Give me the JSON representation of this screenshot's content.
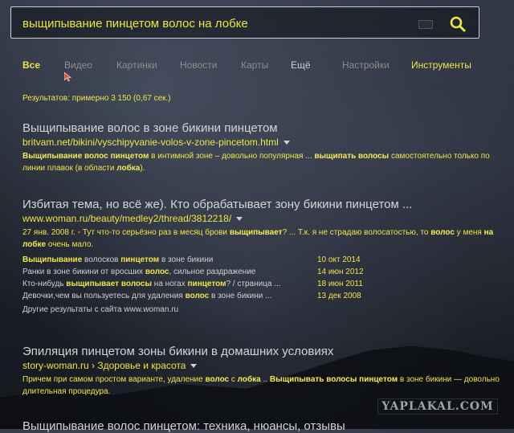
{
  "search": {
    "query": "выщипывание пинцетом волос на лобке"
  },
  "tabs": [
    {
      "label": "Все"
    },
    {
      "label": "Видео"
    },
    {
      "label": "Картинки"
    },
    {
      "label": "Новости"
    },
    {
      "label": "Карты"
    },
    {
      "label": "Ещё"
    },
    {
      "label": "Настройки"
    },
    {
      "label": "Инструменты"
    }
  ],
  "stats": "Результатов: примерно 3 150 (0,67 сек.)",
  "results": [
    {
      "title": "Выщипывание волос в зоне бикини пинцетом",
      "url": "britvam.net/bikini/vyschipyvanie-volos-v-zone-pincetom.html",
      "snippet_parts": [
        {
          "b": true,
          "t": "Выщипывание волос пинцетом"
        },
        {
          "b": false,
          "t": " в интимной зоне – довольно популярная ... "
        },
        {
          "b": true,
          "t": "выщипать волосы"
        },
        {
          "b": false,
          "t": " самостоятельно только по линии плавок (в области "
        },
        {
          "b": true,
          "t": "лобка"
        },
        {
          "b": false,
          "t": ")."
        }
      ]
    },
    {
      "title": "Избитая тема, но всё же). Кто обрабатывает зону бикини пинцетом ...",
      "url": "www.woman.ru/beauty/medley2/thread/3812218/",
      "snippet_parts": [
        {
          "b": false,
          "t": "27 янв. 2008 г. - Тут что-то серьёзно раз в месяц брови "
        },
        {
          "b": true,
          "t": "выщипывает"
        },
        {
          "b": false,
          "t": "? ... Т.к. я не страдаю волосатостью, то "
        },
        {
          "b": true,
          "t": "волос"
        },
        {
          "b": false,
          "t": " у меня "
        },
        {
          "b": true,
          "t": "на лобке"
        },
        {
          "b": false,
          "t": " очень мало."
        }
      ],
      "subresults": [
        {
          "parts": [
            {
              "b": true,
              "t": "Выщипывание"
            },
            {
              "b": false,
              "t": " волосков "
            },
            {
              "b": true,
              "t": "пинцетом"
            },
            {
              "b": false,
              "t": " в зоне бикини"
            }
          ],
          "date": "10 окт 2014"
        },
        {
          "parts": [
            {
              "b": false,
              "t": "Ранки в зоне бикини от вросших "
            },
            {
              "b": true,
              "t": "волос"
            },
            {
              "b": false,
              "t": ", сильное раздражение"
            }
          ],
          "date": "14 июн 2012"
        },
        {
          "parts": [
            {
              "b": false,
              "t": "Кто-нибудь "
            },
            {
              "b": true,
              "t": "выщипывает волосы"
            },
            {
              "b": false,
              "t": " на ногах "
            },
            {
              "b": true,
              "t": "пинцетом"
            },
            {
              "b": false,
              "t": "? / страница ..."
            }
          ],
          "date": "18 июн 2011"
        },
        {
          "parts": [
            {
              "b": false,
              "t": "Девочки,чем вы пользуетесь для удаления "
            },
            {
              "b": true,
              "t": "волос"
            },
            {
              "b": false,
              "t": " в зоне бикини ..."
            }
          ],
          "date": "13 дек 2008"
        }
      ],
      "more": "Другие результаты с сайта www.woman.ru"
    },
    {
      "title": "Эпиляция пинцетом зоны бикини в домашних условиях",
      "url": "story-woman.ru › Здоровье и красота",
      "snippet_parts": [
        {
          "b": false,
          "t": "Причем при самом простом варианте, удаление "
        },
        {
          "b": true,
          "t": "волос"
        },
        {
          "b": false,
          "t": " с "
        },
        {
          "b": true,
          "t": "лобка"
        },
        {
          "b": false,
          "t": " .. "
        },
        {
          "b": true,
          "t": "Выщипывать волосы пинцетом"
        },
        {
          "b": false,
          "t": " в зоне бикини — довольно длительная процедура."
        }
      ]
    },
    {
      "title": "Выщипывание волос пинцетом: техника, нюансы, отзывы"
    }
  ],
  "watermark": "YAPLAKAL.COM",
  "colors": {
    "accent": "#f0e44a",
    "muted": "#8d8d8d",
    "title": "#d4d4d4"
  }
}
